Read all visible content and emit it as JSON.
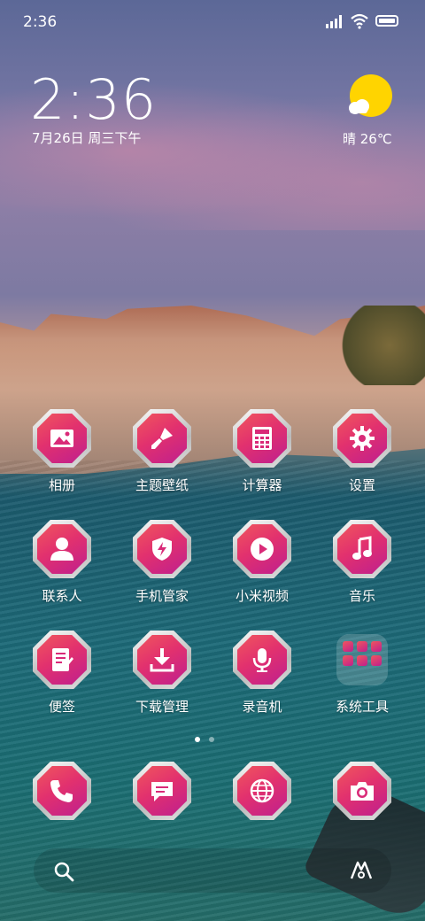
{
  "status": {
    "time": "2:36"
  },
  "lock": {
    "clock": "2:36",
    "date": "7月26日 周三下午",
    "weather": "晴 26℃"
  },
  "apps": [
    {
      "label": "相册",
      "icon": "gallery-icon"
    },
    {
      "label": "主题壁纸",
      "icon": "brush-icon"
    },
    {
      "label": "计算器",
      "icon": "calculator-icon"
    },
    {
      "label": "设置",
      "icon": "gear-icon"
    },
    {
      "label": "联系人",
      "icon": "person-icon"
    },
    {
      "label": "手机管家",
      "icon": "shield-icon"
    },
    {
      "label": "小米视频",
      "icon": "play-icon"
    },
    {
      "label": "音乐",
      "icon": "music-note-icon"
    },
    {
      "label": "便签",
      "icon": "note-icon"
    },
    {
      "label": "下载管理",
      "icon": "download-icon"
    },
    {
      "label": "录音机",
      "icon": "microphone-icon"
    },
    {
      "label": "系统工具",
      "icon": "folder-icon"
    }
  ],
  "dock": [
    {
      "icon": "phone-icon"
    },
    {
      "icon": "message-icon"
    },
    {
      "icon": "globe-icon"
    },
    {
      "icon": "camera-icon"
    }
  ],
  "pager": {
    "pages": 2,
    "current": 1
  },
  "colors": {
    "badge_start": "#f0565d",
    "badge_end": "#bf1f8e",
    "sun": "#ffd400"
  }
}
